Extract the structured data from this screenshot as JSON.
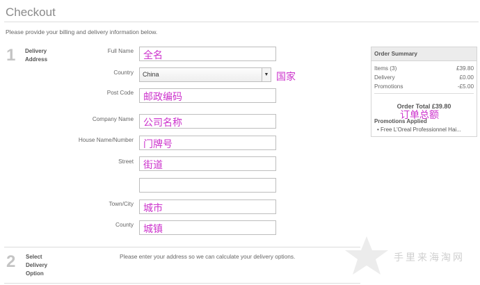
{
  "page": {
    "title": "Checkout",
    "intro": "Please provide your billing and delivery information below."
  },
  "steps": [
    {
      "number": "1",
      "label": "Delivery Address"
    },
    {
      "number": "2",
      "label": "Select Delivery Option"
    }
  ],
  "form": {
    "fields": [
      {
        "label": "Full Name",
        "annotation": "全名"
      },
      {
        "label": "Country",
        "value": "China",
        "annotation": "国家"
      },
      {
        "label": "Post Code",
        "annotation": "邮政编码"
      },
      {
        "label": "Company Name",
        "annotation": "公司名称"
      },
      {
        "label": "House Name/Number",
        "annotation": "门牌号"
      },
      {
        "label": "Street",
        "annotation": "街道"
      },
      {
        "label": "Town/City",
        "annotation": "城市"
      },
      {
        "label": "County",
        "annotation": "城镇"
      }
    ],
    "delivery_message": "Please enter your address so we can calculate your delivery options."
  },
  "summary": {
    "title": "Order Summary",
    "rows": [
      {
        "label": "Items (3)",
        "value": "£39.80"
      },
      {
        "label": "Delivery",
        "value": "£0.00"
      },
      {
        "label": "Promotions",
        "value": "-£5.00"
      }
    ],
    "order_total": "Order Total £39.80",
    "order_total_annotation": "订单总额",
    "promotions_title": "Promotions Applied",
    "promotions": [
      "Free L'Oreal Professionnel Hai..."
    ]
  },
  "watermark": {
    "text": "手里来海淘网"
  },
  "colors": {
    "annotation": "#cc33cc",
    "step_number": "#c4c4c4",
    "summary_header": "#ececec"
  }
}
